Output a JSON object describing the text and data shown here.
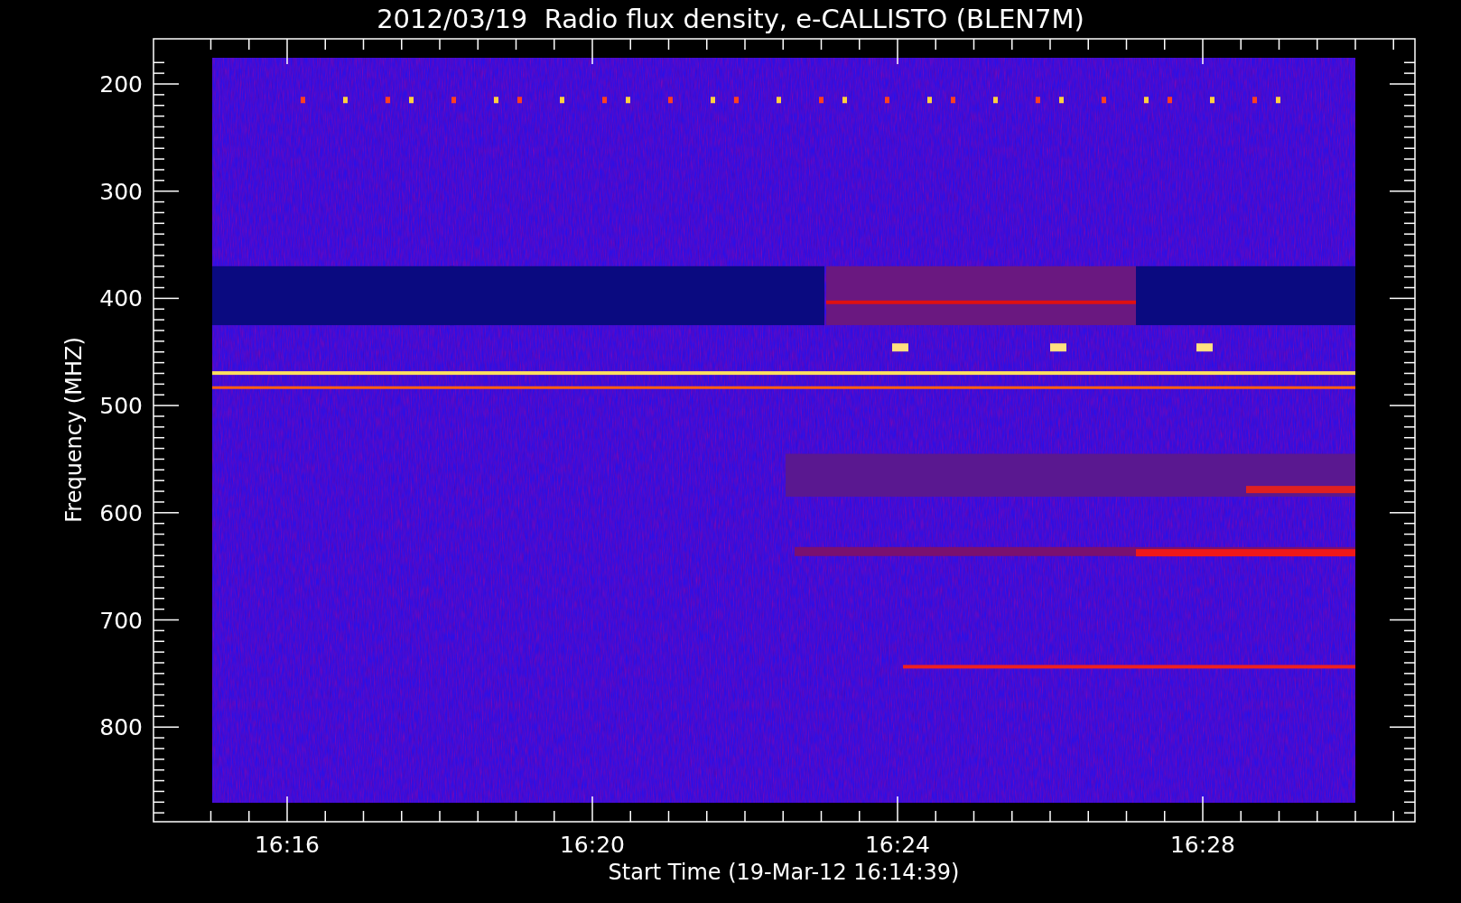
{
  "title": "2012/03/19  Radio flux density, e-CALLISTO (BLEN7M)",
  "y_axis": {
    "label": "Frequency (MHZ)",
    "ticks": [
      "200",
      "300",
      "400",
      "500",
      "600",
      "700",
      "800"
    ]
  },
  "x_axis": {
    "label": "Start Time (19-Mar-12 16:14:39)",
    "ticks": [
      "16:16",
      "16:20",
      "16:24",
      "16:28"
    ]
  }
}
